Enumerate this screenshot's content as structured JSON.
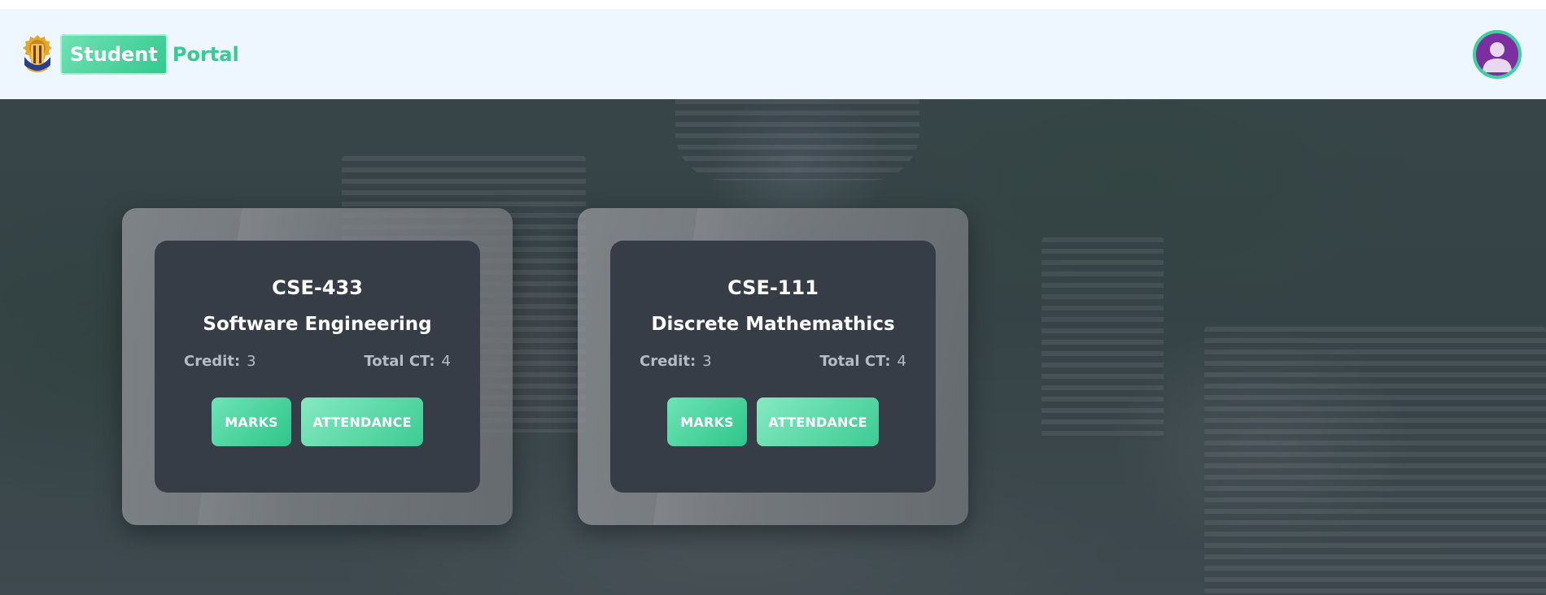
{
  "header": {
    "brand_student": "Student",
    "brand_portal": "Portal",
    "logo_icon": "university-crest-icon",
    "avatar_icon": "user-avatar-icon"
  },
  "colors": {
    "accent": "#3cc98f",
    "navbar_bg": "#eef6ff",
    "card_inner_bg": "#373d46",
    "avatar_bg": "#7b2fa1"
  },
  "courses": [
    {
      "code": "CSE-433",
      "name": "Software Engineering",
      "credit_label": "Credit:",
      "credit": "3",
      "ct_label": "Total CT:",
      "ct": "4",
      "marks_label": "MARKS",
      "attendance_label": "ATTENDANCE"
    },
    {
      "code": "CSE-111",
      "name": "Discrete Mathemathics",
      "credit_label": "Credit:",
      "credit": "3",
      "ct_label": "Total CT:",
      "ct": "4",
      "marks_label": "MARKS",
      "attendance_label": "ATTENDANCE"
    }
  ]
}
